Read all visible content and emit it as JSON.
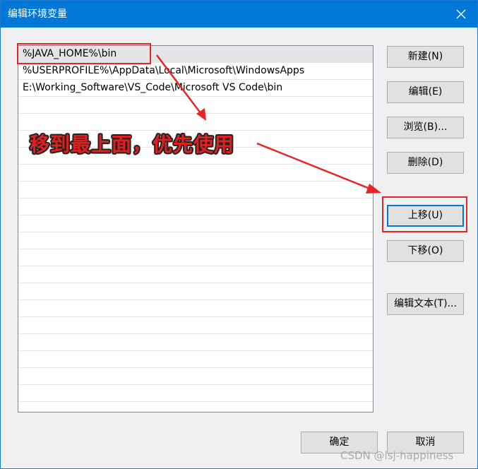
{
  "window": {
    "title": "编辑环境变量"
  },
  "path_list": {
    "items": [
      "%JAVA_HOME%\\bin",
      "%USERPROFILE%\\AppData\\Local\\Microsoft\\WindowsApps",
      "E:\\Working_Software\\VS_Code\\Microsoft VS Code\\bin"
    ],
    "selected_index": 0
  },
  "buttons": {
    "new": "新建(N)",
    "edit": "编辑(E)",
    "browse": "浏览(B)...",
    "delete": "删除(D)",
    "move_up": "上移(U)",
    "move_down": "下移(O)",
    "edit_text": "编辑文本(T)...",
    "ok": "确定",
    "cancel": "取消"
  },
  "annotation": {
    "text": "移到最上面，优先使用",
    "color": "#e02020"
  },
  "watermark": "CSDN @lsj-happiness",
  "colors": {
    "titlebar": "#0078d7",
    "highlight": "#e5252a",
    "focus": "#0078d7"
  }
}
